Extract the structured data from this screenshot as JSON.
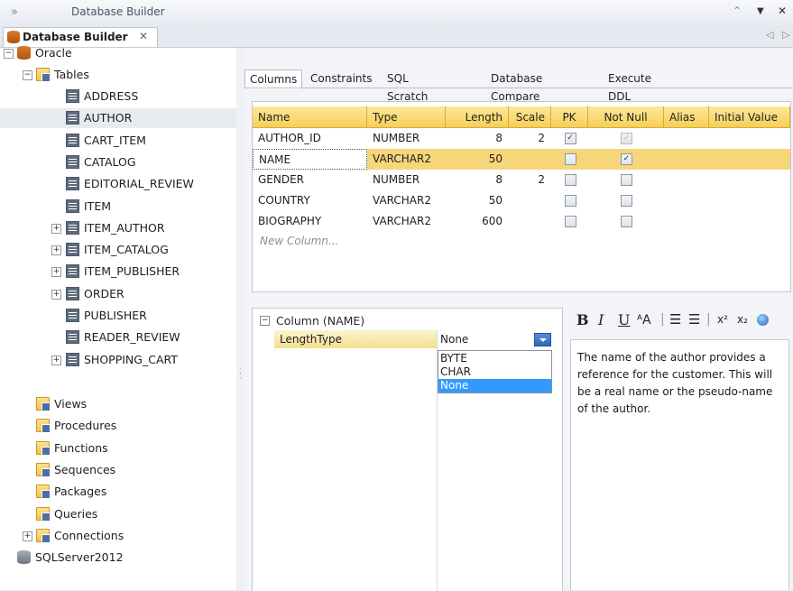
{
  "window": {
    "title": "Database Builder",
    "overflow_chevrons": "»",
    "collapse_glyph": "⌃",
    "menu_glyph": "▼",
    "close_glyph": "✕"
  },
  "doc_tab": {
    "label": "Database Builder",
    "close": "✕",
    "nav_left": "◁",
    "nav_right": "▷"
  },
  "tree": {
    "oracle": "Oracle",
    "tables": "Tables",
    "table_items": [
      "ADDRESS",
      "AUTHOR",
      "CART_ITEM",
      "CATALOG",
      "EDITORIAL_REVIEW",
      "ITEM",
      "ITEM_AUTHOR",
      "ITEM_CATALOG",
      "ITEM_PUBLISHER",
      "ORDER",
      "PUBLISHER",
      "READER_REVIEW",
      "SHOPPING_CART"
    ],
    "selected_table": "AUTHOR",
    "folders": [
      "Views",
      "Procedures",
      "Functions",
      "Sequences",
      "Packages",
      "Queries",
      "Connections"
    ],
    "sqlserver": "SQLServer2012",
    "expand_plus": "+",
    "expand_minus": "−"
  },
  "subtabs": [
    "Columns",
    "Constraints",
    "SQL Scratch Pad",
    "Database Compare",
    "Execute DDL"
  ],
  "grid": {
    "headers": [
      "Name",
      "Type",
      "Length",
      "Scale",
      "PK",
      "Not Null",
      "Alias",
      "Initial Value"
    ],
    "rows": [
      {
        "name": "AUTHOR_ID",
        "type": "NUMBER",
        "length": "8",
        "scale": "2",
        "pk": true,
        "notnull": true,
        "notnull_dim": true
      },
      {
        "name": "NAME",
        "type": "VARCHAR2",
        "length": "50",
        "scale": "",
        "pk": false,
        "notnull": true,
        "notnull_dim": false
      },
      {
        "name": "GENDER",
        "type": "NUMBER",
        "length": "8",
        "scale": "2",
        "pk": false,
        "notnull": false,
        "notnull_dim": false
      },
      {
        "name": "COUNTRY",
        "type": "VARCHAR2",
        "length": "50",
        "scale": "",
        "pk": false,
        "notnull": false,
        "notnull_dim": false
      },
      {
        "name": "BIOGRAPHY",
        "type": "VARCHAR2",
        "length": "600",
        "scale": "",
        "pk": false,
        "notnull": false,
        "notnull_dim": false
      }
    ],
    "selected_row": 1,
    "new_column": "New Column...",
    "check_glyph": "✓"
  },
  "props": {
    "category": "Column (NAME)",
    "collapse": "−",
    "property_name": "LengthType",
    "property_value": "None",
    "options": [
      "BYTE",
      "CHAR",
      "None"
    ],
    "selected_option": "None"
  },
  "notes_toolbar": [
    "B",
    "I",
    "U",
    "ᴬA",
    "|",
    "☰",
    "☰",
    "|",
    "x²",
    "x₂"
  ],
  "notes": {
    "text": "The name of the author provides a reference for the customer. This will be a real name or the pseudo-name of the author."
  },
  "colors": {
    "accent_header": "#f7cf58",
    "selected_row": "#f7d57a",
    "dropdown_selected": "#3399ff"
  }
}
